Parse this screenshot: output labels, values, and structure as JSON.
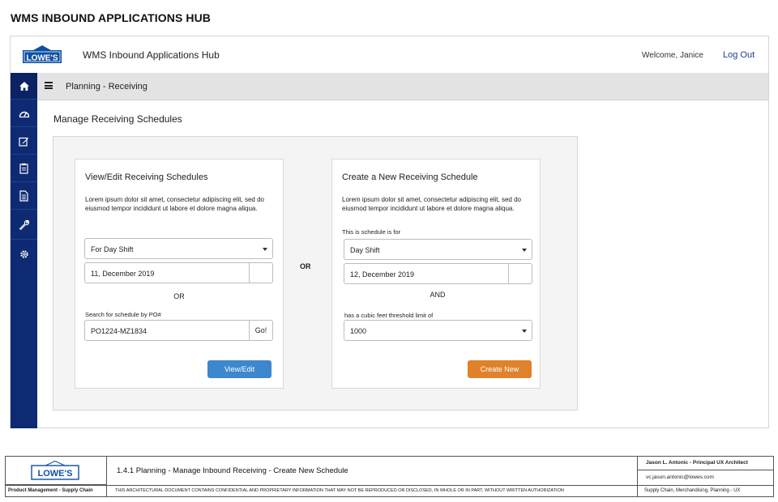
{
  "page_title": "WMS INBOUND APPLICATIONS HUB",
  "header": {
    "brand": "LOWE'S",
    "app_name": "WMS Inbound Applications Hub",
    "welcome": "Welcome, Janice",
    "logout": "Log Out"
  },
  "sidebar": {
    "items": [
      {
        "icon": "home-icon"
      },
      {
        "icon": "dashboard-icon"
      },
      {
        "icon": "edit-icon"
      },
      {
        "icon": "clipboard-icon"
      },
      {
        "icon": "document-icon"
      },
      {
        "icon": "wrench-icon"
      },
      {
        "icon": "gear-icon"
      }
    ]
  },
  "subbar": {
    "title": "Planning - Receiving"
  },
  "main": {
    "section_title": "Manage Receiving Schedules",
    "or_between": "OR",
    "view_card": {
      "title": "View/Edit Receiving Schedules",
      "description": "Lorem ipsum dolor sit amet, consectetur adipiscing elit, sed do eiusmod tempor incididunt ut labore et dolore magna aliqua.",
      "shift_select": "For Day Shift",
      "date": "11, December 2019",
      "or_label": "OR",
      "po_label": "Search for schedule by PO#",
      "po_value": "PO1224-MZ1834",
      "go_label": "Go!",
      "button": "View/Edit"
    },
    "create_card": {
      "title": "Create a New Receiving Schedule",
      "description": "Lorem ipsum dolor sit amet, consectetur adipiscing elit, sed do eiusmod tempor incididunt ut labore et dolore magna aliqua.",
      "schedule_for_label": "This is schedule is for",
      "shift_select": "Day Shift",
      "date": "12, December 2019",
      "and_label": "AND",
      "threshold_label": "has a cubic feet threshold limit of",
      "threshold_value": "1000",
      "button": "Create New"
    }
  },
  "footer": {
    "brand": "LOWE'S",
    "doc_title": "1.4.1 Planning - Manage Inbound Receiving - Create New Schedule",
    "author": "Jason L. Antonic - Principal UX Architect",
    "email": "vc.jason.antonic@lowes.com",
    "department": "Product Management - Supply Chain",
    "confidential": "THIS ARCHITECTURAL DOCUMENT CONTAINS CONFIDENTIAL AND PROPRIETARY INFORMATION THAT MAY NOT BE REPRODUCED OR DISCLOSED, IN WHOLE OR IN PART, WITHOUT WRITTEN AUTHORIZATION",
    "area": "Supply Chain, Merchandising, Planning - UX"
  },
  "colors": {
    "brand_blue": "#0e2a73",
    "view_button": "#3d87cd",
    "create_button": "#e0812b"
  }
}
